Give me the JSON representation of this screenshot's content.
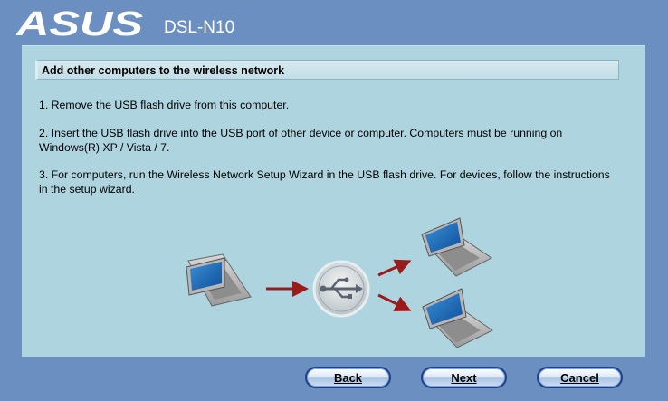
{
  "header": {
    "brand": "ASUS",
    "model": "DSL-N10"
  },
  "content": {
    "title": "Add other computers to the wireless network",
    "steps": [
      "1. Remove the USB flash drive from this computer.",
      "2. Insert the USB flash drive into the USB port of other device or computer. Computers must be running on Windows(R) XP / Vista / 7.",
      "3. For computers, run the Wireless Network Setup Wizard in the USB flash drive. For devices, follow the instructions in the setup wizard."
    ]
  },
  "buttons": {
    "back": "Back",
    "next": "Next",
    "cancel": "Cancel"
  },
  "illustration": {
    "icons": [
      "laptop-icon",
      "usb-icon",
      "laptop-icon",
      "laptop-icon"
    ],
    "arrow_color": "#9b1b1b"
  },
  "colors": {
    "background": "#6b8fc0",
    "panel": "#aed4e0",
    "button_border": "#1d3f86"
  }
}
